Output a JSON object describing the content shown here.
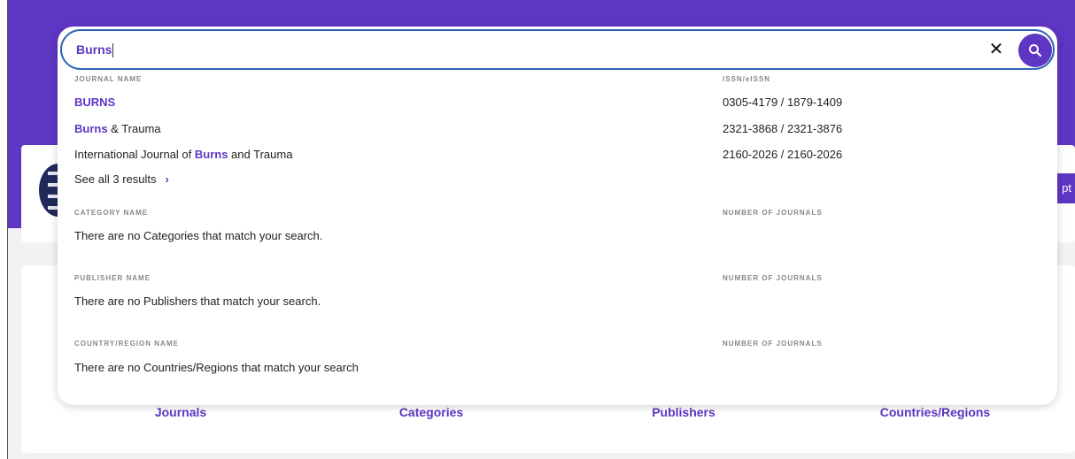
{
  "search": {
    "value": "Burns",
    "clear_icon": "close-icon",
    "search_icon": "search-icon"
  },
  "journals": {
    "name_header": "JOURNAL NAME",
    "issn_header": "ISSN/eISSN",
    "rows": [
      {
        "pre": "",
        "match": "BURNS",
        "post": "",
        "issn": "0305-4179 / 1879-1409"
      },
      {
        "pre": "",
        "match": "Burns",
        "post": " & Trauma",
        "issn": "2321-3868 / 2321-3876"
      },
      {
        "pre": "International Journal of ",
        "match": "Burns",
        "post": " and Trauma",
        "issn": "2160-2026 / 2160-2026"
      }
    ],
    "see_all": "See all 3 results"
  },
  "categories": {
    "name_header": "CATEGORY NAME",
    "count_header": "NUMBER OF JOURNALS",
    "empty": "There are no Categories that match your search."
  },
  "publishers": {
    "name_header": "PUBLISHER NAME",
    "count_header": "NUMBER OF JOURNALS",
    "empty": "There are no Publishers that match your search."
  },
  "countries": {
    "name_header": "COUNTRY/REGION NAME",
    "count_header": "NUMBER OF JOURNALS",
    "empty": "There are no Countries/Regions that match your search"
  },
  "background": {
    "export_label": "pt",
    "tabs": [
      "Journals",
      "Categories",
      "Publishers",
      "Countries/Regions"
    ]
  },
  "colors": {
    "accent": "#5f35c4",
    "focus_border": "#2f66b3"
  }
}
